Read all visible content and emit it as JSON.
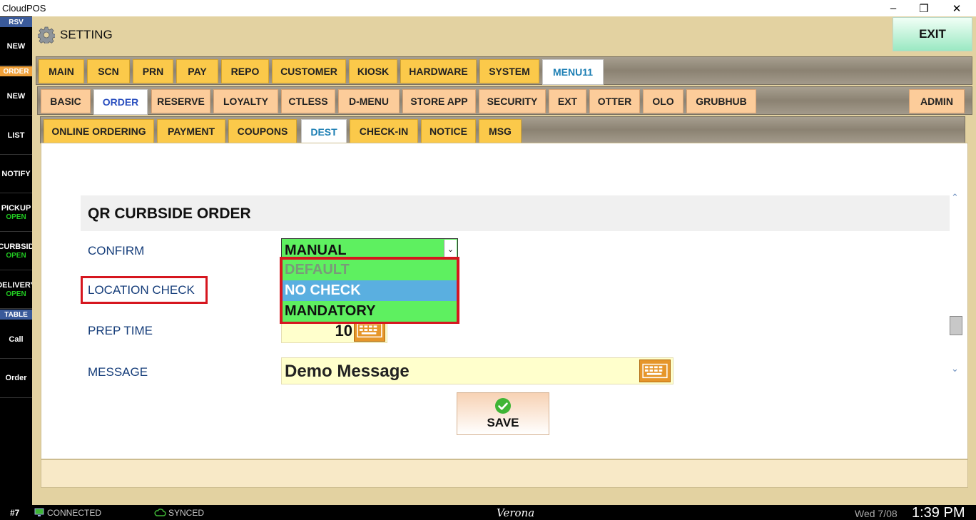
{
  "window": {
    "title": "CloudPOS",
    "minimize": "–",
    "restore": "❐",
    "close": "✕"
  },
  "sidebar": {
    "rsv_label": "RSV",
    "order_label": "ORDER",
    "table_label": "TABLE",
    "items": [
      {
        "label": "NEW",
        "sub": ""
      },
      {
        "label": "NEW",
        "sub": ""
      },
      {
        "label": "LIST",
        "sub": ""
      },
      {
        "label": "NOTIFY",
        "sub": ""
      },
      {
        "label": "PICKUP",
        "sub": "OPEN"
      },
      {
        "label": "CURBSID",
        "sub": "OPEN"
      },
      {
        "label": "DELIVERY",
        "sub": "OPEN"
      },
      {
        "label": "Call",
        "sub": ""
      },
      {
        "label": "Order",
        "sub": ""
      }
    ]
  },
  "header": {
    "title": "SETTING",
    "exit_label": "EXIT",
    "icon": "gear-icon"
  },
  "tabs_main": [
    "MAIN",
    "SCN",
    "PRN",
    "PAY",
    "REPO",
    "CUSTOMER",
    "KIOSK",
    "HARDWARE",
    "SYSTEM",
    "MENU11"
  ],
  "tabs_sub": [
    "BASIC",
    "ORDER",
    "RESERVE",
    "LOYALTY",
    "CTLESS",
    "D-MENU",
    "STORE APP",
    "SECURITY",
    "EXT",
    "OTTER",
    "OLO",
    "GRUBHUB",
    "ADMIN"
  ],
  "tabs_sub2": [
    "ONLINE ORDERING",
    "PAYMENT",
    "COUPONS",
    "DEST",
    "CHECK-IN",
    "NOTICE",
    "MSG"
  ],
  "section": {
    "title": "QR CURBSIDE ORDER",
    "confirm_label": "CONFIRM",
    "confirm_value": "MANUAL",
    "location_check_label": "LOCATION CHECK",
    "location_options": [
      "DEFAULT",
      "NO CHECK",
      "MANDATORY"
    ],
    "prep_time_label": "PREP TIME",
    "prep_time_value": "10",
    "message_label": "MESSAGE",
    "message_value": "Demo Message",
    "save_label": "SAVE"
  },
  "status": {
    "station": "#7",
    "connected": "CONNECTED",
    "synced": "SYNCED",
    "store": "Verona",
    "date": "Wed 7/08",
    "time": "1:39 PM"
  },
  "colors": {
    "tab_yellow": "#fbc94a",
    "tab_peach": "#fccc9a",
    "dropdown_green": "#5ef060",
    "selected_blue": "#5aafe0",
    "highlight_red": "#d6161f"
  }
}
